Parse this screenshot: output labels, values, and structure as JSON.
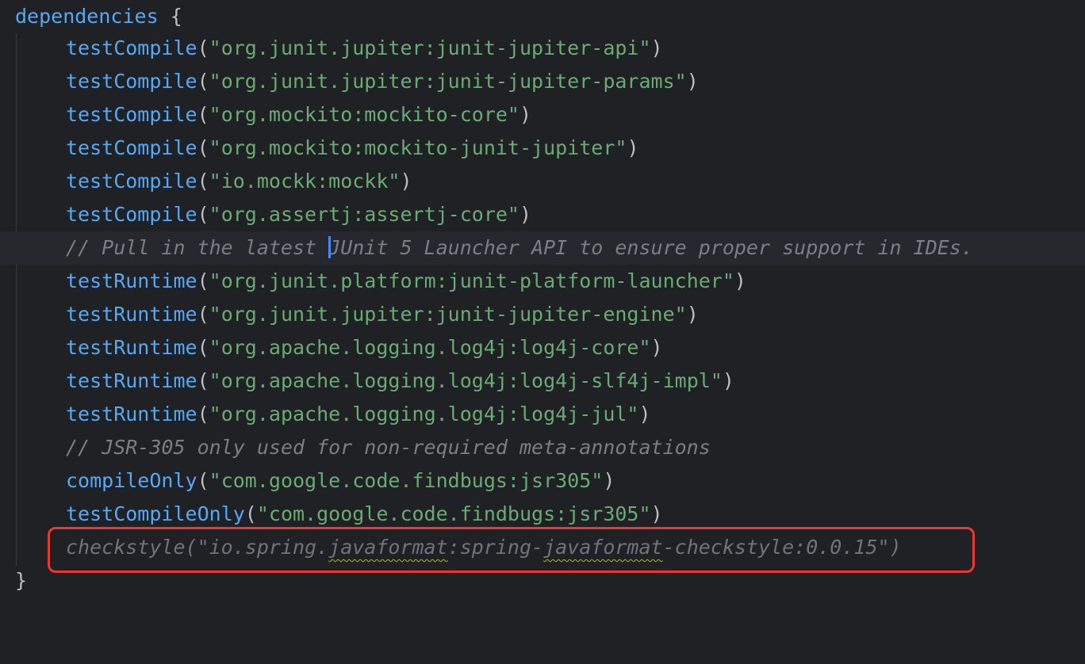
{
  "editor": {
    "block_keyword": "dependencies",
    "open_brace": "{",
    "close_brace": "}",
    "lines": [
      {
        "kind": "call",
        "fn": "testCompile",
        "arg": "\"org.junit.jupiter:junit-jupiter-api\""
      },
      {
        "kind": "call",
        "fn": "testCompile",
        "arg": "\"org.junit.jupiter:junit-jupiter-params\""
      },
      {
        "kind": "call",
        "fn": "testCompile",
        "arg": "\"org.mockito:mockito-core\""
      },
      {
        "kind": "call",
        "fn": "testCompile",
        "arg": "\"org.mockito:mockito-junit-jupiter\""
      },
      {
        "kind": "call",
        "fn": "testCompile",
        "arg": "\"io.mockk:mockk\""
      },
      {
        "kind": "call",
        "fn": "testCompile",
        "arg": "\"org.assertj:assertj-core\""
      },
      {
        "kind": "comment",
        "text_before_caret": "// Pull in the latest ",
        "text_after_caret": "JUnit 5 Launcher API to ensure proper support in IDEs."
      },
      {
        "kind": "call",
        "fn": "testRuntime",
        "arg": "\"org.junit.platform:junit-platform-launcher\""
      },
      {
        "kind": "call",
        "fn": "testRuntime",
        "arg": "\"org.junit.jupiter:junit-jupiter-engine\""
      },
      {
        "kind": "call",
        "fn": "testRuntime",
        "arg": "\"org.apache.logging.log4j:log4j-core\""
      },
      {
        "kind": "call",
        "fn": "testRuntime",
        "arg": "\"org.apache.logging.log4j:log4j-slf4j-impl\""
      },
      {
        "kind": "call",
        "fn": "testRuntime",
        "arg": "\"org.apache.logging.log4j:log4j-jul\""
      },
      {
        "kind": "comment",
        "text": "// JSR-305 only used for non-required meta-annotations"
      },
      {
        "kind": "call",
        "fn": "compileOnly",
        "arg": "\"com.google.code.findbugs:jsr305\""
      },
      {
        "kind": "call",
        "fn": "testCompileOnly",
        "arg": "\"com.google.code.findbugs:jsr305\""
      }
    ],
    "unused_line": {
      "p1": "checkstyle(\"io.spring.",
      "p2": "javaformat",
      "p3": ":spring-",
      "p4": "javaformat",
      "p5": "-checkstyle:0.0.15\")"
    },
    "colors": {
      "keyword": "#56a8f5",
      "string": "#6aab73",
      "comment": "#7a7e85",
      "highlight_border": "#e8382f",
      "background": "#1f2124"
    }
  }
}
